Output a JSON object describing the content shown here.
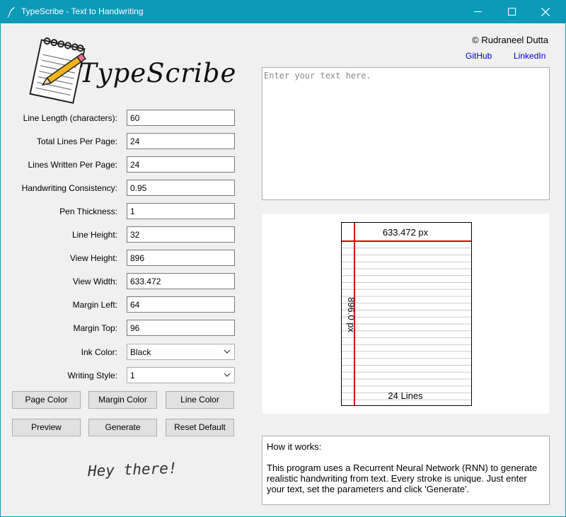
{
  "window": {
    "title": "TypeScribe - Text to Handwriting"
  },
  "logo": {
    "text": "TypeScribe"
  },
  "form": [
    {
      "label": "Line Length (characters):",
      "value": "60",
      "name": "line-length"
    },
    {
      "label": "Total Lines Per Page:",
      "value": "24",
      "name": "total-lines"
    },
    {
      "label": "Lines Written Per Page:",
      "value": "24",
      "name": "lines-written"
    },
    {
      "label": "Handwriting Consistency:",
      "value": "0.95",
      "name": "consistency"
    },
    {
      "label": "Pen Thickness:",
      "value": "1",
      "name": "pen-thickness"
    },
    {
      "label": "Line Height:",
      "value": "32",
      "name": "line-height"
    },
    {
      "label": "View Height:",
      "value": "896",
      "name": "view-height"
    },
    {
      "label": "View Width:",
      "value": "633.472",
      "name": "view-width"
    },
    {
      "label": "Margin Left:",
      "value": "64",
      "name": "margin-left"
    },
    {
      "label": "Margin Top:",
      "value": "96",
      "name": "margin-top"
    }
  ],
  "selects": [
    {
      "label": "Ink Color:",
      "value": "Black",
      "name": "ink-color"
    },
    {
      "label": "Writing Style:",
      "value": "1",
      "name": "writing-style"
    }
  ],
  "buttons": {
    "page_color": "Page Color",
    "margin_color": "Margin Color",
    "line_color": "Line Color",
    "preview": "Preview",
    "generate": "Generate",
    "reset": "Reset Default"
  },
  "signature": "Hey there!",
  "header": {
    "copyright": "© Rudraneel Dutta",
    "github": "GitHub",
    "linkedin": "LinkedIn"
  },
  "textarea": {
    "placeholder": "Enter your text here."
  },
  "preview": {
    "width_label": "633.472 px",
    "height_label": "896.0 px",
    "lines_label": "24 Lines",
    "line_count": 24,
    "margin_color": "#e00000",
    "line_color": "#c8c8c8"
  },
  "how": {
    "title": "How it works:",
    "body": "This program uses a Recurrent Neural Network (RNN) to generate realistic handwriting from text. Every stroke is unique. Just enter your text, set the parameters and click 'Generate'."
  },
  "colors": {
    "titlebar": "#0d99b8",
    "link": "#0000e0"
  }
}
